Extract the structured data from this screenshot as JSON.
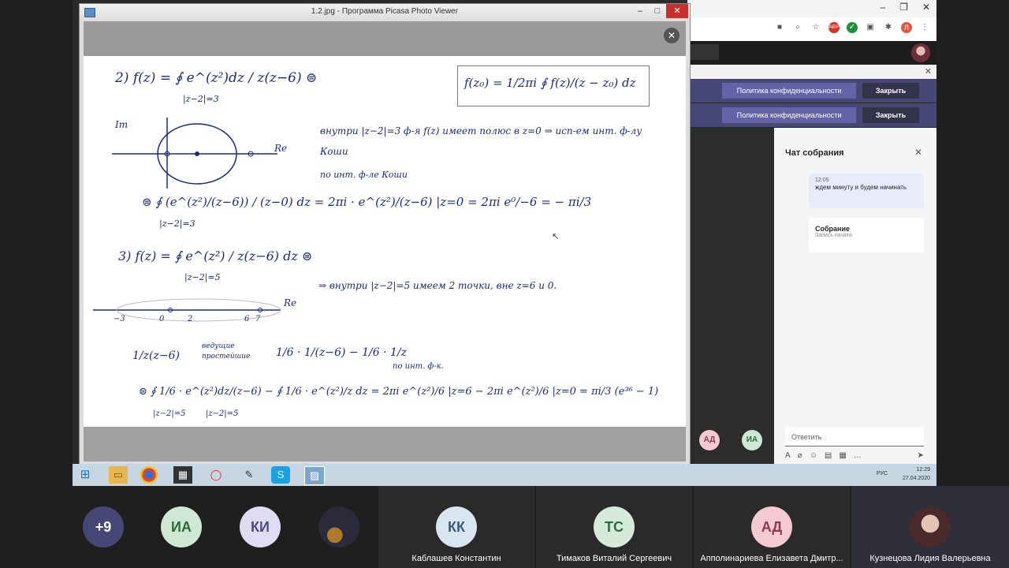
{
  "picasa": {
    "title": "1.2.jpg - Программа Picasa Photo Viewer"
  },
  "notes": {
    "l1": "2)  f(z) = ∮ e^(z²)dz / z(z−6)  ⊜",
    "l1b": "|z−2|=3",
    "formula": "f(z₀) = 1/2πi ∮ f(z)/(z − z₀) dz",
    "l2": "внутри |z−2|=3  ф-я f(z) имеет полюс в z=0 ⇒ исп-ем инт. ф-лу Коши",
    "axis1a": "Im",
    "axis1b": "Re",
    "l3": "по инт. ф-ле Коши",
    "l4": "⊜ ∮ (e^(z²)/(z−6)) / (z−0) dz = 2πi · e^(z²)/(z−6) |z=0 = 2πi e⁰/−6 = − πi/3",
    "l4b": "|z−2|=3",
    "l5": "3)  f(z) = ∮ e^(z²) / z(z−6) dz  ⊜",
    "l5b": "|z−2|=5",
    "l6": "⇒ внутри |z−2|=5 имеем 2 точки, вне z=6 и 0.",
    "axis2": [
      "−3",
      "0",
      "2",
      "6",
      "7",
      "Re"
    ],
    "l7a": "1/z(z−6)",
    "l7b": "ведущие простейшие",
    "l7c": "1/6 · 1/(z−6) − 1/6 · 1/z",
    "l7d": "по инт. ф-к.",
    "l8": "⊜ ∮ 1/6 · e^(z²)dz/(z−6) − ∮ 1/6 · e^(z²)/z dz = 2πi e^(z²)/6 |z=6 − 2πi e^(z²)/6 |z=0 = πi/3 (e³⁶ − 1)",
    "l8b": "|z−2|=5        |z−2|=5"
  },
  "teams": {
    "privacy_label": "Политика конфиденциальности",
    "close_label": "Закрыть",
    "chat_title": "Чат собрания",
    "msg1_time": "12:05",
    "msg1_text": "ждем минуту и будем начинать",
    "msg2_title": "Собрание",
    "msg2_sub": "Запись начата",
    "reply_placeholder": "Ответить",
    "stage_av1": "АД",
    "stage_av2": "ИА"
  },
  "taskbar": {
    "lang": "РУС",
    "time": "12:29",
    "date": "27.04.2020"
  },
  "participants": {
    "more": "+9",
    "p1": "ИА",
    "p2": "КИ",
    "p3_initials": "КК",
    "p3_name": "Каблашев Константин",
    "p4_initials": "ТС",
    "p4_name": "Тимаков Виталий Сергеевич",
    "p5_initials": "АД",
    "p5_name": "Апполинариева Елизавета Дмитр...",
    "p6_name": "Кузнецова Лидия Валерьевна"
  },
  "colors": {
    "ink": "#1d2a7a",
    "teams_purple": "#6264a7",
    "taskbar": "#c7d6e3"
  }
}
